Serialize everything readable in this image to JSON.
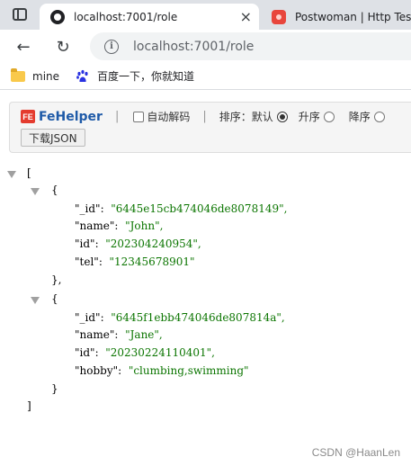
{
  "browser": {
    "tabs": [
      {
        "title": "localhost:7001/role",
        "active": true
      },
      {
        "title": "Postwoman | Http Test",
        "active": false
      }
    ],
    "close_glyph": "×",
    "back_glyph": "←",
    "reload_glyph": "↻",
    "info_glyph": "i",
    "url": "localhost:7001/role",
    "bookmarks": [
      {
        "label": "mine",
        "icon": "folder-icon"
      },
      {
        "label": "百度一下，你就知道",
        "icon": "baidu-paw-icon"
      }
    ]
  },
  "fehelper": {
    "logo": "FE",
    "brand": "FeHelper",
    "separator": "|",
    "auto_decode_label": "自动解码",
    "sort_label": "排序：",
    "sort_options": [
      "默认",
      "升序",
      "降序"
    ],
    "sort_selected": "默认",
    "download_label": "下载JSON"
  },
  "json_lines": [
    {
      "text": "["
    },
    {
      "text": "{"
    },
    {
      "key": "\"_id\"",
      "value": "\"6445e15cb474046de8078149\","
    },
    {
      "key": "\"name\"",
      "value": "\"John\","
    },
    {
      "key": "\"id\"",
      "value": "\"202304240954\","
    },
    {
      "key": "\"tel\"",
      "value": "\"12345678901\""
    },
    {
      "text": "},"
    },
    {
      "text": "{"
    },
    {
      "key": "\"_id\"",
      "value": "\"6445f1ebb474046de807814a\","
    },
    {
      "key": "\"name\"",
      "value": "\"Jane\","
    },
    {
      "key": "\"id\"",
      "value": "\"20230224110401\","
    },
    {
      "key": "\"hobby\"",
      "value": "\"clumbing,swimming\""
    },
    {
      "text": "}"
    },
    {
      "text": "]"
    }
  ],
  "watermark": "CSDN @HaanLen",
  "colors": {
    "string_value": "#0b7500",
    "fehelper_brand": "#1e5aa8",
    "fehelper_logo": "#e43b2e"
  }
}
